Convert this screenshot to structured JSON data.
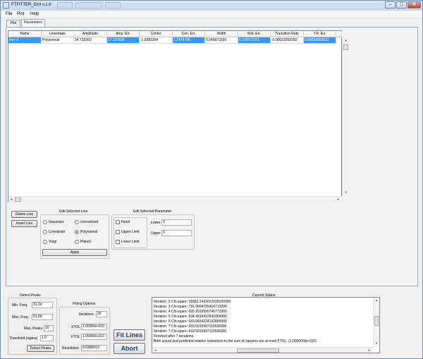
{
  "window": {
    "title": "FTFITTER_GUI v.1.0",
    "ghost_tabs": [
      "",
      "",
      ""
    ]
  },
  "titlebar": {
    "minimize": "–",
    "maximize": "□",
    "close": "✕"
  },
  "menu": [
    "File",
    "Plot",
    "Help"
  ],
  "tabs": [
    "Plot",
    "Parameters"
  ],
  "table": {
    "columns": [
      "Name",
      "Lineshape",
      "Amplitude",
      "Amp. Err.",
      "Center",
      "Cen. Err.",
      "Width",
      "Wid. Err.",
      "Transition Rate",
      "T.R. Err."
    ],
    "rows": [
      [
        "line: 0",
        "Polynomial",
        "24.719360",
        "17.116508",
        "-1.8383354",
        "1.2479798",
        "0.045873199",
        "0.030072371",
        "-0.00023359250",
        "0.00023955622"
      ]
    ]
  },
  "line_list": {
    "delete": "Delete Line",
    "insert": "Insert Line"
  },
  "edit_line": {
    "title": "Edit Selected Line",
    "options": [
      "Gaussian",
      "Unresolved",
      "Lorentzian",
      "Polynomial",
      "Voigt",
      "Planck"
    ],
    "selected": "Polynomial",
    "apply": "Apply"
  },
  "edit_param": {
    "title": "Edit Selected Parameter",
    "fixed": "Fixed",
    "upper_limit": "Upper Limit",
    "lower_limit": "Lower Limit",
    "lower_label": "Lower",
    "lower_value": "0",
    "upper_label": "Upper",
    "upper_value": "0"
  },
  "detect": {
    "title": "Detect Peaks",
    "min_freq_label": "Min. Freq.",
    "min_freq": "31.2d",
    "max_freq_label": "Max. Freq.",
    "max_freq": "51.8d",
    "max_peaks_label": "Max. Peaks",
    "max_peaks": "10",
    "threshold_label": "Threshold (sigma)",
    "threshold": "1.0",
    "button": "Detect Peaks"
  },
  "fitting": {
    "title": "Fitting Options",
    "iterations_label": "Iterations",
    "iterations": "20",
    "xtol_label": "XTOL",
    "xtol": "1.00000e-010",
    "ftol_label": "FTOL",
    "ftol": "1.00000e-010",
    "resolution_label": "Resolution",
    "resolution": "0.0395413"
  },
  "actions": {
    "fit": "Fit Lines",
    "abort": "Abort"
  },
  "status": {
    "title": "Current Status:",
    "lines": [
      "Iteration: 2  Chi-sqare: 31862.2433017618100000",
      "Iteration: 3  Chi-sqare: 731.9904725416719200",
      "Iteration: 4  Chi-sqare: 635.2015595746772900",
      "Iteration: 5  Chi-sqare: 634.4319413341054300",
      "Iteration: 6  Chi-sqare: 633.5834224152899900",
      "Iteration: 7  Chi-sqare: 633.5015997115536900",
      "Iteration: 7  Chi-sqare: 633.5015997115536900",
      "Finished after 7 iterations.",
      "Both actual and predicted relative reductions in the sum of squares are at most FTOL. (1.0000000e-010)"
    ]
  }
}
